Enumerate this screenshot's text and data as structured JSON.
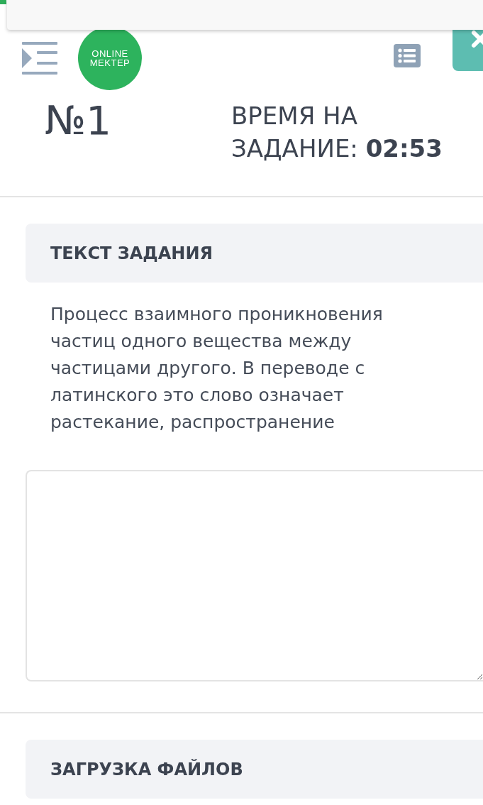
{
  "header": {
    "logo": {
      "lines": [
        "ONLINE",
        "MEKTEP"
      ]
    }
  },
  "task": {
    "number": "№1",
    "timer": {
      "label": "ВРЕМЯ НА ЗАДАНИЕ:",
      "value": "02:53"
    }
  },
  "sections": [
    {
      "kind": "question",
      "title": "ТЕКСТ ЗАДАНИЯ",
      "text": "Процесс взаимного проникновения частиц одного вещества между частицами другого. В переводе с латинского это слово означает растекание, распространение"
    },
    {
      "kind": "upload",
      "title": "ЗАГРУЗКА ФАЙЛОВ"
    }
  ]
}
